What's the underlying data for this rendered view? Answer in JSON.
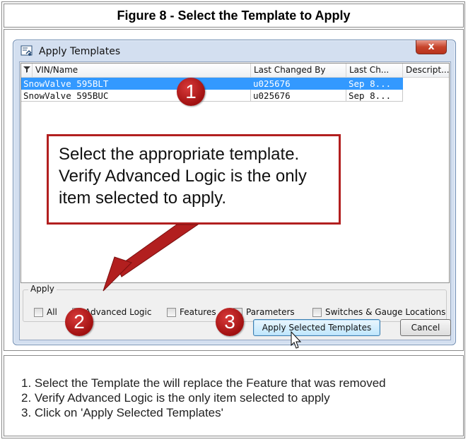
{
  "figure_title": "Figure 8 - Select the Template to Apply",
  "dialog": {
    "title": "Apply Templates",
    "close_label": "x",
    "columns": [
      "VIN/Name",
      "Last Changed By",
      "Last Ch...",
      "Descript..."
    ],
    "rows": [
      {
        "name": "SnowValve 595BLT",
        "changed_by": "u025676",
        "last_changed": "Sep 8...",
        "description": "",
        "selected": true
      },
      {
        "name": "SnowValve 595BUC",
        "changed_by": "u025676",
        "last_changed": "Sep 8...",
        "description": "",
        "selected": false
      }
    ],
    "apply_group_label": "Apply",
    "apply_options": [
      {
        "label": "All",
        "checked": false
      },
      {
        "label": "Advanced Logic",
        "checked": true
      },
      {
        "label": "Features",
        "checked": false
      },
      {
        "label": "Parameters",
        "checked": false
      },
      {
        "label": "Switches & Gauge Locations",
        "checked": false
      }
    ],
    "apply_button_label": "Apply Selected Templates",
    "cancel_button_label": "Cancel"
  },
  "callout": {
    "text": "Select the appropriate template. Verify Advanced Logic is the only item selected to apply."
  },
  "badges": [
    "1",
    "2",
    "3"
  ],
  "notes": [
    "1.  Select the Template the will replace the Feature that was removed",
    "2.  Verify Advanced Logic is the only item selected to apply",
    "3.  Click on 'Apply Selected Templates'"
  ],
  "colors": {
    "selection": "#3399ff",
    "annotation_red": "#b21f1f",
    "dialog_frame": "#d3dff0"
  }
}
